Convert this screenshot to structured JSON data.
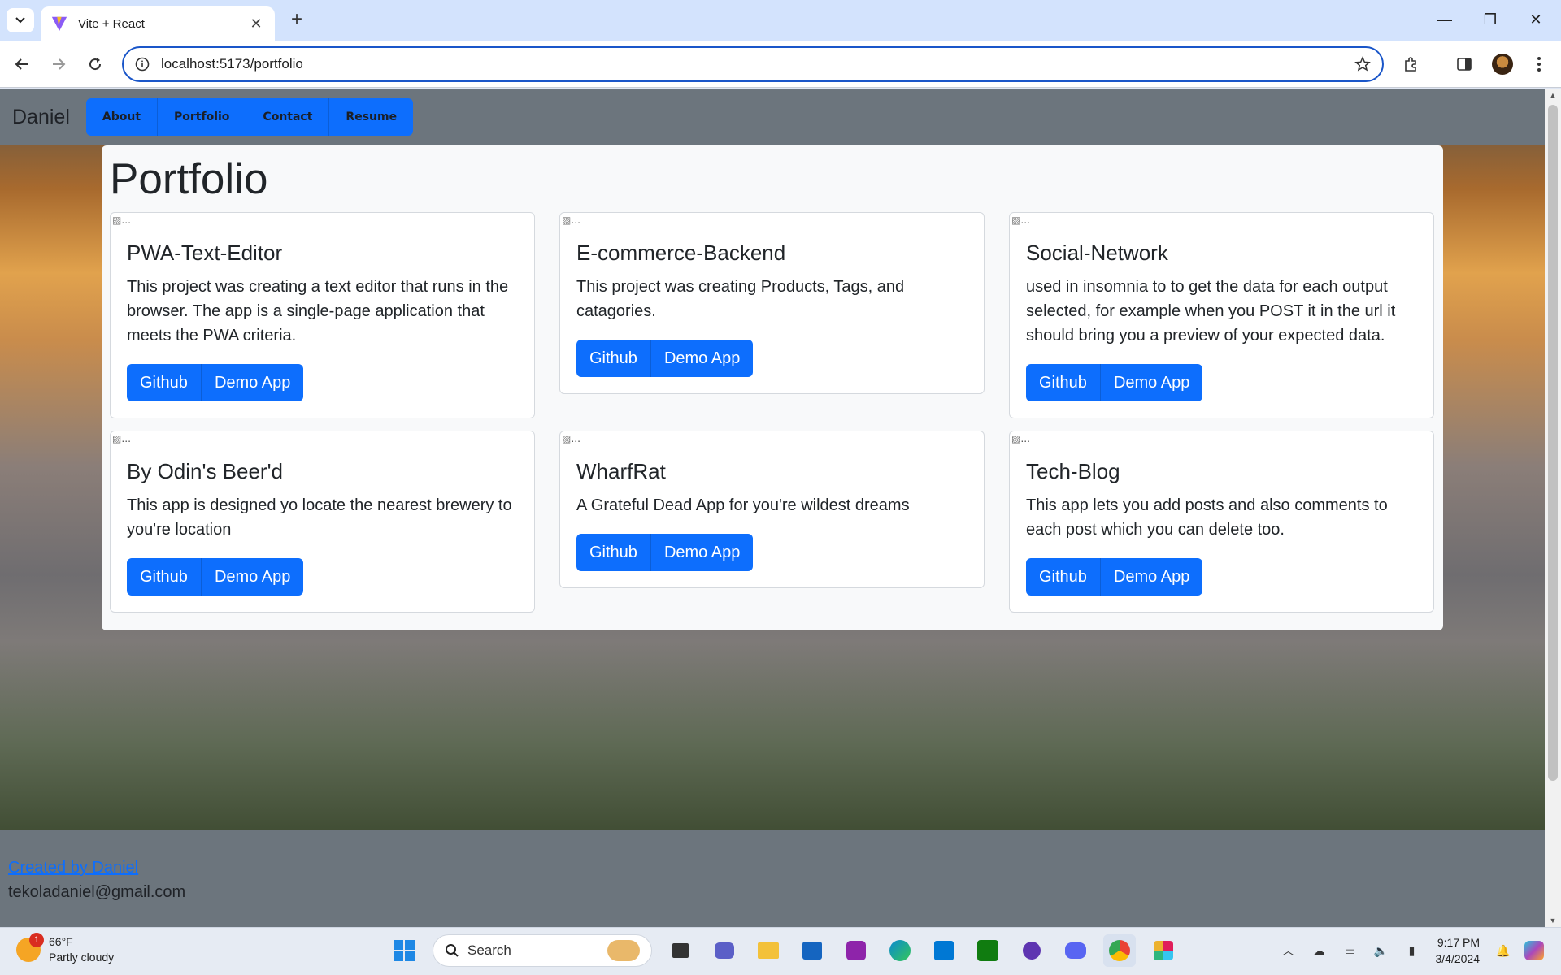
{
  "browser": {
    "tab_title": "Vite + React",
    "url": "localhost:5173/portfolio"
  },
  "site": {
    "brand": "Daniel",
    "nav": [
      "About",
      "Portfolio",
      "Contact",
      "Resume"
    ],
    "heading": "Portfolio",
    "image_alt": "...",
    "projects": [
      {
        "title": "PWA-Text-Editor",
        "description": "This project was creating a text editor that runs in the browser. The app is a single-page application that meets the PWA criteria.",
        "github": "Github",
        "demo": "Demo App"
      },
      {
        "title": "E-commerce-Backend",
        "description": "This project was creating Products, Tags, and catagories.",
        "github": "Github",
        "demo": "Demo App"
      },
      {
        "title": "Social-Network",
        "description": "used in insomnia to to get the data for each output selected, for example when you POST it in the url it should bring you a preview of your expected data.",
        "github": "Github",
        "demo": "Demo App"
      },
      {
        "title": "By Odin's Beer'd",
        "description": "This app is designed yo locate the nearest brewery to you're location",
        "github": "Github",
        "demo": "Demo App"
      },
      {
        "title": "WharfRat",
        "description": "A Grateful Dead App for you're wildest dreams",
        "github": "Github",
        "demo": "Demo App"
      },
      {
        "title": "Tech-Blog",
        "description": "This app lets you add posts and also comments to each post which you can delete too.",
        "github": "Github",
        "demo": "Demo App"
      }
    ],
    "footer": {
      "credit": "Created by Daniel",
      "email": "tekoladaniel@gmail.com"
    }
  },
  "taskbar": {
    "weather_badge": "1",
    "temperature": "66°F",
    "condition": "Partly cloudy",
    "search_placeholder": "Search",
    "time": "9:17 PM",
    "date": "3/4/2024"
  },
  "colors": {
    "primary": "#0d6efd",
    "navbar": "#6c757d",
    "card_bg": "#f8f9fa"
  }
}
